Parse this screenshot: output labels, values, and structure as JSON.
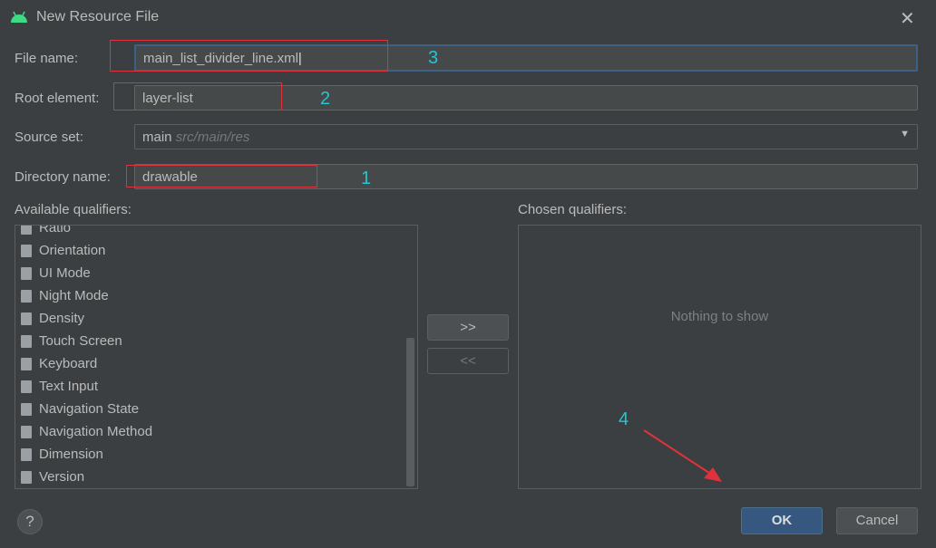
{
  "window": {
    "title": "New Resource File",
    "icon": "android-icon",
    "close_icon": "close-icon"
  },
  "form": {
    "file_name": {
      "label": "File name:",
      "value": "main_list_divider_line.xml"
    },
    "root_element": {
      "label": "Root element:",
      "value": "layer-list"
    },
    "source_set": {
      "label": "Source set:",
      "value": "main",
      "hint": "src/main/res"
    },
    "directory_name": {
      "label": "Directory name:",
      "value": "drawable"
    }
  },
  "available": {
    "label": "Available qualifiers:",
    "items": [
      {
        "label": "Ratio",
        "icon": "ratio-icon"
      },
      {
        "label": "Orientation",
        "icon": "orientation-icon"
      },
      {
        "label": "UI Mode",
        "icon": "ui-mode-icon"
      },
      {
        "label": "Night Mode",
        "icon": "night-mode-icon"
      },
      {
        "label": "Density",
        "icon": "density-icon"
      },
      {
        "label": "Touch Screen",
        "icon": "touch-screen-icon"
      },
      {
        "label": "Keyboard",
        "icon": "keyboard-icon"
      },
      {
        "label": "Text Input",
        "icon": "text-input-icon"
      },
      {
        "label": "Navigation State",
        "icon": "navigation-state-icon"
      },
      {
        "label": "Navigation Method",
        "icon": "navigation-method-icon"
      },
      {
        "label": "Dimension",
        "icon": "dimension-icon"
      },
      {
        "label": "Version",
        "icon": "version-icon"
      }
    ]
  },
  "chosen": {
    "label": "Chosen qualifiers:",
    "empty": "Nothing to show"
  },
  "buttons": {
    "add": ">>",
    "remove": "<<",
    "ok": "OK",
    "cancel": "Cancel",
    "help": "?"
  },
  "annotations": {
    "n1": "1",
    "n2": "2",
    "n3": "3",
    "n4": "4",
    "color": "#e0323c",
    "number_color": "#22c6d2"
  }
}
